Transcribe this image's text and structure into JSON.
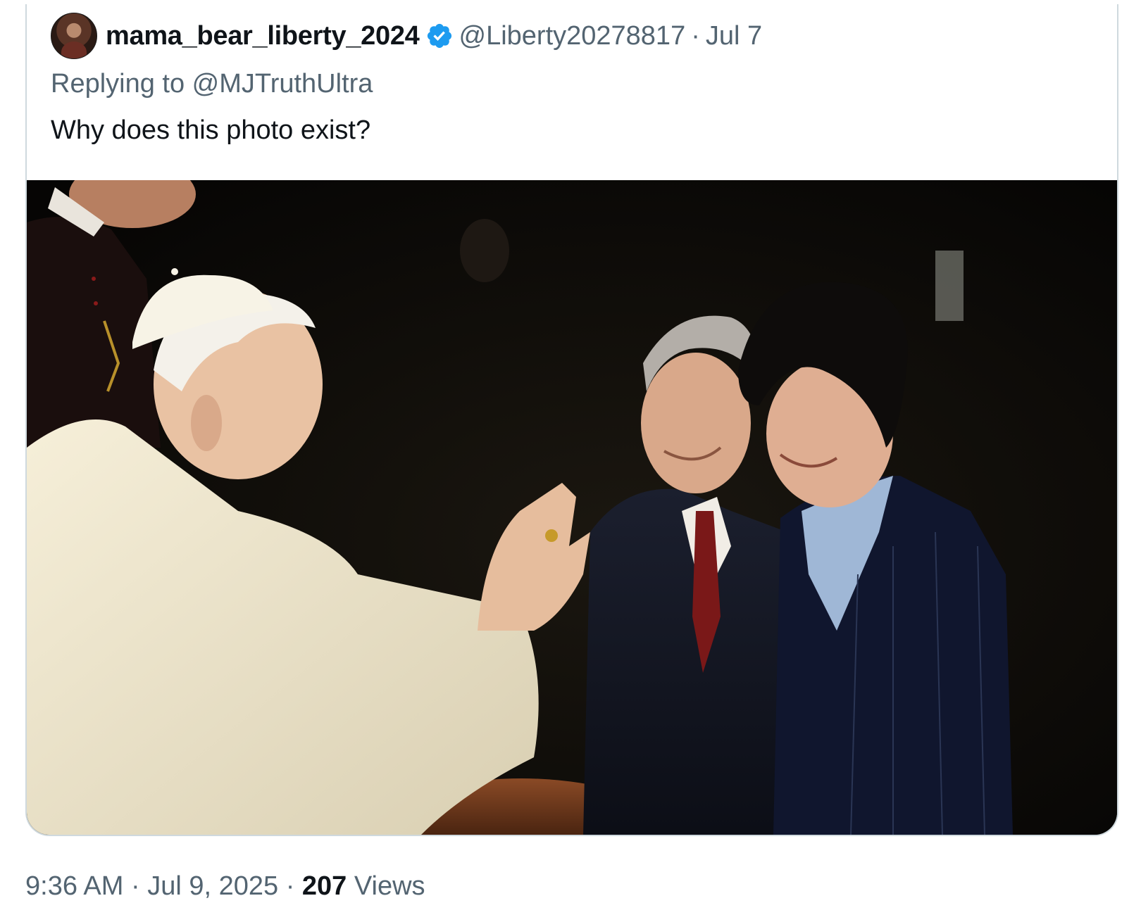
{
  "quoted_post": {
    "author": {
      "display_name": "mama_bear_liberty_2024",
      "handle": "@Liberty20278817",
      "verified": true
    },
    "separator": "·",
    "date": "Jul 7",
    "replying_to_prefix": "Replying to ",
    "replying_to_handle": "@MJTruthUltra",
    "text": "Why does this photo exist?",
    "media": {
      "type": "photo"
    }
  },
  "post_meta": {
    "time": "9:36 AM",
    "separator": "·",
    "date": "Jul 9, 2025",
    "views_count": "207",
    "views_label": "Views"
  },
  "colors": {
    "text_primary": "#0f1419",
    "text_secondary": "#536471",
    "verified_badge": "#1d9bf0",
    "card_border": "#cfd9de"
  },
  "icons": {
    "verified": "verified-badge-icon"
  }
}
